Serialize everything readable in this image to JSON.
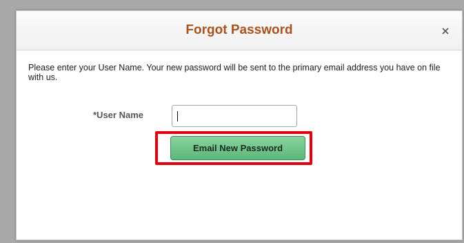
{
  "dialog": {
    "title": "Forgot Password",
    "close_label": "×",
    "instructions": "Please enter your User Name. Your new password will be sent to the primary email address you have on file with us."
  },
  "form": {
    "username_label": "*User Name",
    "username_value": "",
    "submit_label": "Email New Password"
  },
  "colors": {
    "title": "#a6531f",
    "button": "#5cb779",
    "highlight": "#e3000f"
  }
}
